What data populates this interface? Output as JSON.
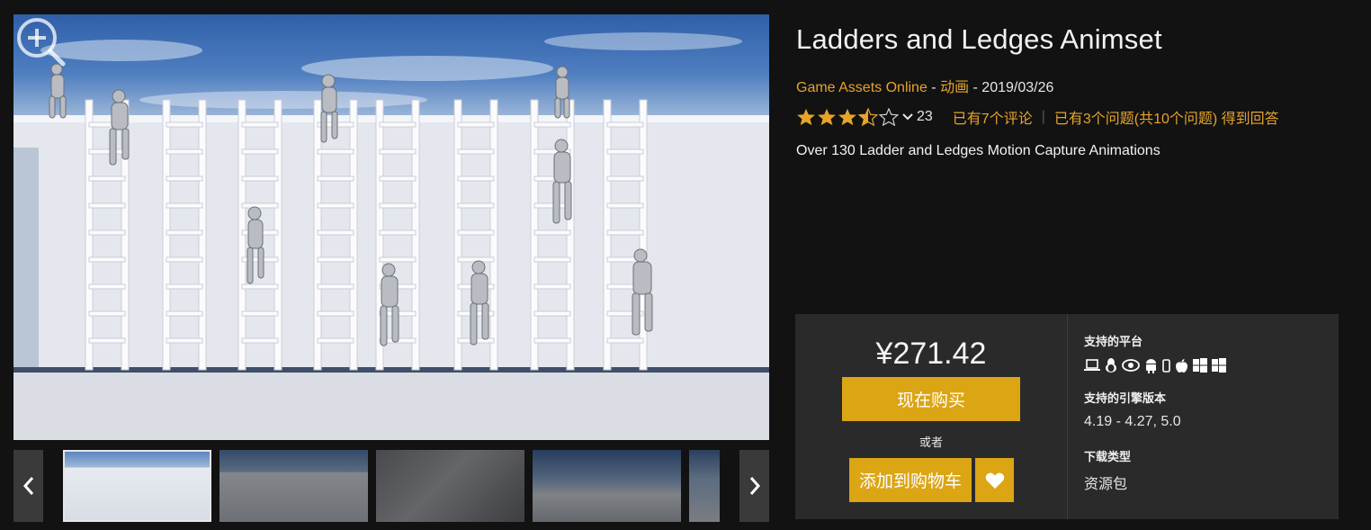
{
  "product": {
    "title": "Ladders and Ledges Animset",
    "seller": "Game Assets Online",
    "meta_sep1": " - ",
    "category": "动画",
    "meta_sep2": " - ",
    "date": "2019/03/26",
    "rating": 3.5,
    "rating_count": "23",
    "reviews_link": "已有7个评论",
    "questions_link": "已有3个问题(共10个问题) 得到回答",
    "short_description": "Over 130 Ladder and Ledges Motion Capture Animations"
  },
  "purchase": {
    "price": "¥271.42",
    "buy_now": "现在购买",
    "or": "或者",
    "add_to_cart": "添加到购物车"
  },
  "specs": {
    "platforms_label": "支持的平台",
    "platforms": [
      "laptop-icon",
      "linux-icon",
      "vr-eye-icon",
      "android-icon",
      "mobile-icon",
      "apple-icon",
      "windows-icon",
      "windows-icon"
    ],
    "engine_label": "支持的引擎版本",
    "engine_versions": "4.19 - 4.27, 5.0",
    "download_label": "下载类型",
    "download_type": "资源包"
  },
  "gallery": {
    "thumbnails": [
      "thumbnail-1",
      "thumbnail-2",
      "thumbnail-3",
      "thumbnail-4",
      "thumbnail-5"
    ],
    "active_index": 0
  },
  "colors": {
    "accent": "#dba514",
    "link": "#e6a32c",
    "background": "#121212",
    "panel": "#2a2a2a"
  }
}
